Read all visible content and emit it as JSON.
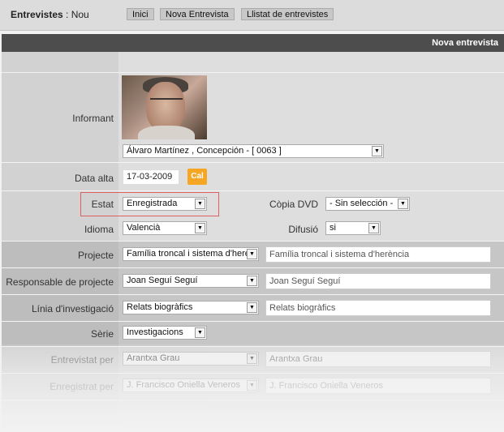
{
  "header": {
    "title_bold": "Entrevistes",
    "title_separator": " : ",
    "title_rest": "Nou",
    "nav": [
      "Inici",
      "Nova Entrevista",
      "Llistat de entrevistes"
    ]
  },
  "section_title": "Nova entrevista",
  "form": {
    "informant": {
      "label": "Informant",
      "value": "Álvaro Martínez , Concepción - [ 0063 ]"
    },
    "data_alta": {
      "label": "Data alta",
      "value": "17-03-2009",
      "button": "Cal"
    },
    "estat": {
      "label": "Estat",
      "value": "Enregistrada"
    },
    "copia_dvd": {
      "label": "Còpia DVD",
      "value": "- Sin selección -"
    },
    "idioma": {
      "label": "Idioma",
      "value": "Valencià"
    },
    "difusio": {
      "label": "Difusió",
      "value": "si"
    },
    "projecte": {
      "label": "Projecte",
      "value": "Família troncal i sistema d'herè",
      "text": "Família troncal i sistema d'herència"
    },
    "responsable": {
      "label": "Responsable de projecte",
      "value": "Joan Seguí Seguí",
      "text": "Joan Seguí Seguí"
    },
    "linia": {
      "label": "Línia d'investigació",
      "value": "Relats biogràfics",
      "text": "Relats biogràfics"
    },
    "serie": {
      "label": "Sèrie",
      "value": "Investigacions"
    },
    "entrevistat_per": {
      "label": "Entrevistat per",
      "value": "Arantxa Grau",
      "text": "Arantxa Grau"
    },
    "enregistrat_per": {
      "label": "Enregistrat per",
      "value": "J. Francisco Oniella Veneros",
      "text": "J. Francisco Oniella Veneros"
    }
  },
  "colors": {
    "section_bar": "#4d4d4d",
    "cal_button": "#f5a623",
    "highlight_border": "#e06060"
  }
}
